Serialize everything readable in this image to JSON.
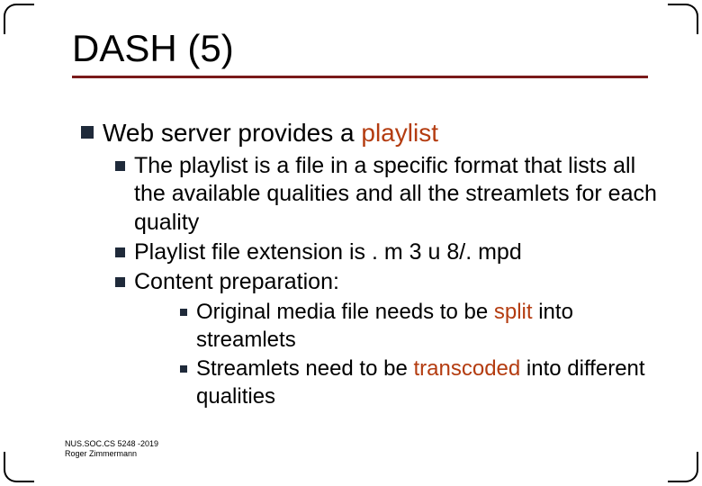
{
  "title": "DASH (5)",
  "lvl1": {
    "pre": "Web server provides a ",
    "hl": "playlist"
  },
  "lvl2": {
    "a": "The playlist is a file in a specific format that lists all the available qualities and all the streamlets for each quality",
    "b": "Playlist file extension is . m 3 u 8/. mpd",
    "c": "Content preparation:"
  },
  "lvl3": {
    "a_pre": "Original media file needs to be ",
    "a_hl": "split",
    "a_post": " into streamlets",
    "b_pre": "Streamlets need to be ",
    "b_hl": "transcoded",
    "b_post": " into different qualities"
  },
  "footer": {
    "line1": "NUS.SOC.CS 5248 -2019",
    "line2": "Roger Zimmermann"
  }
}
